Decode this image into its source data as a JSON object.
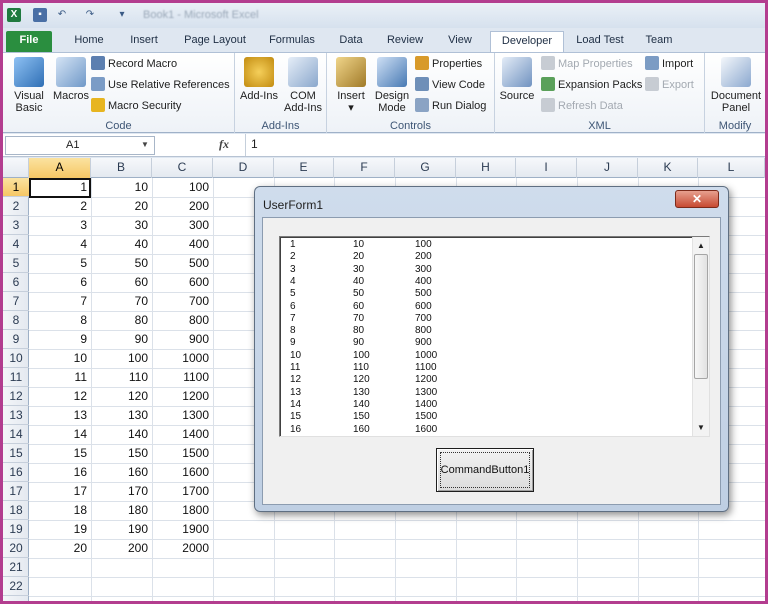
{
  "window": {
    "title": "Book1 - Microsoft Excel",
    "undo": "↶",
    "redo": "↷",
    "qa_drop": "▾",
    "app_icon": "X",
    "save_icon": "▪"
  },
  "tabs": [
    "File",
    "Home",
    "Insert",
    "Page Layout",
    "Formulas",
    "Data",
    "Review",
    "View",
    "Developer",
    "Load Test",
    "Team"
  ],
  "active_tab": "Developer",
  "ribbon": {
    "code": {
      "label": "Code",
      "visual_basic": "Visual Basic",
      "macros": "Macros",
      "record_macro": "Record Macro",
      "relative_refs": "Use Relative References",
      "macro_security": "Macro Security"
    },
    "addins": {
      "label": "Add-Ins",
      "addins": "Add-Ins",
      "com_addins": "COM Add-Ins"
    },
    "controls": {
      "label": "Controls",
      "insert": "Insert",
      "design_mode": "Design Mode",
      "properties": "Properties",
      "view_code": "View Code",
      "run_dialog": "Run Dialog"
    },
    "xml": {
      "label": "XML",
      "source": "Source",
      "map_properties": "Map Properties",
      "expansion_packs": "Expansion Packs",
      "refresh_data": "Refresh Data",
      "import": "Import",
      "export": "Export"
    },
    "modify": {
      "label": "Modify",
      "document_panel": "Document Panel"
    },
    "insert_drop": "▾"
  },
  "formula_bar": {
    "name_box": "A1",
    "name_drop": "▼",
    "fx": "fx",
    "value": "1"
  },
  "columns": [
    "A",
    "B",
    "C",
    "D",
    "E",
    "F",
    "G",
    "H",
    "I",
    "J",
    "K",
    "L"
  ],
  "rows": [
    "1",
    "2",
    "3",
    "4",
    "5",
    "6",
    "7",
    "8",
    "9",
    "10",
    "11",
    "12",
    "13",
    "14",
    "15",
    "16",
    "17",
    "18",
    "19",
    "20",
    "21",
    "22"
  ],
  "cells": {
    "A": [
      "1",
      "2",
      "3",
      "4",
      "5",
      "6",
      "7",
      "8",
      "9",
      "10",
      "11",
      "12",
      "13",
      "14",
      "15",
      "16",
      "17",
      "18",
      "19",
      "20"
    ],
    "B": [
      "10",
      "20",
      "30",
      "40",
      "50",
      "60",
      "70",
      "80",
      "90",
      "100",
      "110",
      "120",
      "130",
      "140",
      "150",
      "160",
      "170",
      "180",
      "190",
      "200"
    ],
    "C": [
      "100",
      "200",
      "300",
      "400",
      "500",
      "600",
      "700",
      "800",
      "900",
      "1000",
      "1100",
      "1200",
      "1300",
      "1400",
      "1500",
      "1600",
      "1700",
      "1800",
      "1900",
      "2000"
    ]
  },
  "userform": {
    "title": "UserForm1",
    "close": "✕",
    "button": "CommandButton1",
    "scroll_up": "▲",
    "scroll_down": "▼",
    "list": [
      [
        "1",
        "10",
        "100"
      ],
      [
        "2",
        "20",
        "200"
      ],
      [
        "3",
        "30",
        "300"
      ],
      [
        "4",
        "40",
        "400"
      ],
      [
        "5",
        "50",
        "500"
      ],
      [
        "6",
        "60",
        "600"
      ],
      [
        "7",
        "70",
        "700"
      ],
      [
        "8",
        "80",
        "800"
      ],
      [
        "9",
        "90",
        "900"
      ],
      [
        "10",
        "100",
        "1000"
      ],
      [
        "11",
        "110",
        "1100"
      ],
      [
        "12",
        "120",
        "1200"
      ],
      [
        "13",
        "130",
        "1300"
      ],
      [
        "14",
        "140",
        "1400"
      ],
      [
        "15",
        "150",
        "1500"
      ],
      [
        "16",
        "160",
        "1600"
      ]
    ]
  },
  "colors": {
    "accent": "#2a8e3f",
    "selected_header": "#f6c765",
    "frame": "#b33d8f"
  }
}
